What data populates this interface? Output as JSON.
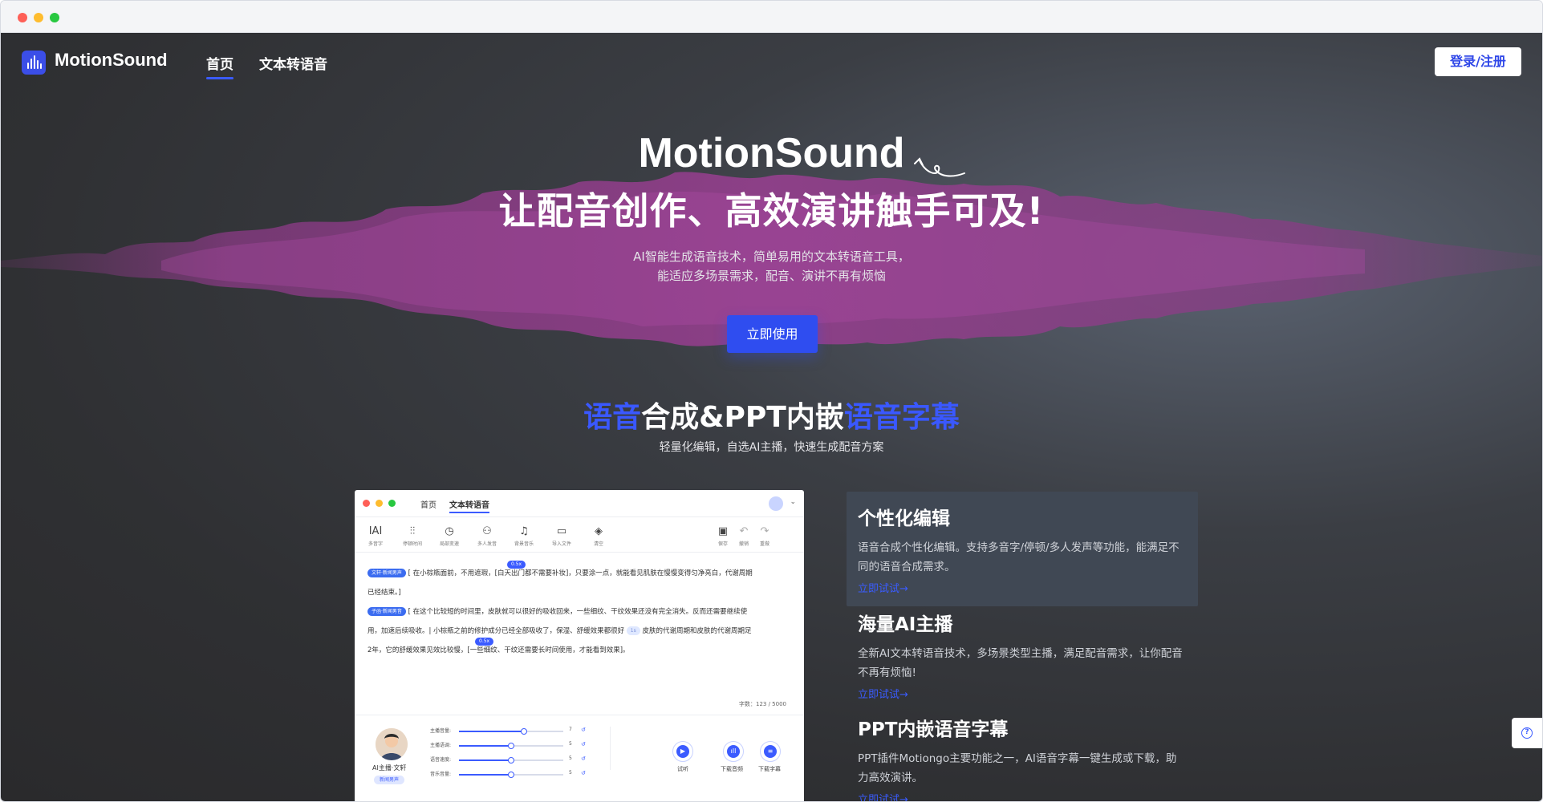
{
  "nav": {
    "logo_text": "MotionSound",
    "links": [
      "首页",
      "文本转语音"
    ],
    "login_label": "登录/注册"
  },
  "hero": {
    "title": "MotionSound",
    "subtitle": "让配音创作、高效演讲触手可及!",
    "desc_line1": "AI智能生成语音技术，简单易用的文本转语音工具，",
    "desc_line2": "能适应多场景需求，配音、演讲不再有烦恼",
    "cta_label": "立即使用"
  },
  "section": {
    "title_part1": "语音",
    "title_part2": "合成&PPT内嵌",
    "title_part3": "语音字幕",
    "desc": "轻量化编辑，自选AI主播，快速生成配音方案"
  },
  "mock": {
    "tabs": [
      "首页",
      "文本转语音"
    ],
    "tools": [
      {
        "icon": "IAI",
        "label": "多音字"
      },
      {
        "icon": "⫶⫶",
        "label": "停顿时间"
      },
      {
        "icon": "◷",
        "label": "局部变速"
      },
      {
        "icon": "⚇",
        "label": "多人发音"
      },
      {
        "icon": "♫",
        "label": "背景音乐"
      },
      {
        "icon": "▭",
        "label": "导入文件"
      },
      {
        "icon": "◈",
        "label": "清空"
      }
    ],
    "right_tools": [
      {
        "icon": "▣",
        "label": "保存"
      },
      {
        "icon": "↶",
        "label": "撤销"
      },
      {
        "icon": "↷",
        "label": "重做"
      }
    ],
    "speed_tag": "0.5x",
    "speed_tag2": "0.5x",
    "para1_tag": "文轩·新闻男声",
    "para1_text": "[ 在小棕瓶面前，不用遮瑕，[白天出门都不需要补妆]，只要涂一点，就能看见肌肤在慢慢变得匀净亮白，代谢周期",
    "para1_end": "已经结束。]",
    "para2_tag": "子函·新闻男音",
    "para2_text": "[ 在这个比较短的时间里，皮肤就可以很好的吸收回来，一些细纹、干纹效果还没有完全消失。反而还需要继续使",
    "para2_line2a": "用，加速后续吸收。| 小棕瓶之前的修护成分已经全部吸收了，保湿、舒缓效果都很好",
    "para2_light_tag": "1s",
    "para2_line2b": "皮肤的代谢周期和皮肤的代谢周期足",
    "para2_line3": "2年，它的舒缓效果见效比较慢，[一些细纹、干纹还需要长时间使用，才能看到效果]。",
    "count": "字数：123 / 5000",
    "host_name": "AI主播·文轩",
    "host_tag": "新闻男声",
    "sliders": [
      {
        "label": "主播音量:",
        "value": "7",
        "level": 0.62
      },
      {
        "label": "主播语调:",
        "value": "5",
        "level": 0.5
      },
      {
        "label": "语音速度:",
        "value": "5",
        "level": 0.5
      },
      {
        "label": "音乐音量:",
        "value": "5",
        "level": 0.5
      }
    ],
    "actions": [
      "试听",
      "下载音频",
      "下载字幕"
    ]
  },
  "features": [
    {
      "title": "个性化编辑",
      "desc": "语音合成个性化编辑。支持多音字/停顿/多人发声等功能，能满足不同的语音合成需求。",
      "link": "立即试试→"
    },
    {
      "title": "海量AI主播",
      "desc": "全新AI文本转语音技术，多场景类型主播，满足配音需求，让你配音不再有烦恼!",
      "link": "立即试试→"
    },
    {
      "title": "PPT内嵌语音字幕",
      "desc": "PPT插件Motiongo主要功能之一，AI语音字幕一键生成或下载，助力高效演讲。",
      "link": "立即试试→"
    }
  ],
  "colors": {
    "accent": "#3b5bff",
    "background": "#2f3033",
    "wave": "#8b3a86"
  }
}
